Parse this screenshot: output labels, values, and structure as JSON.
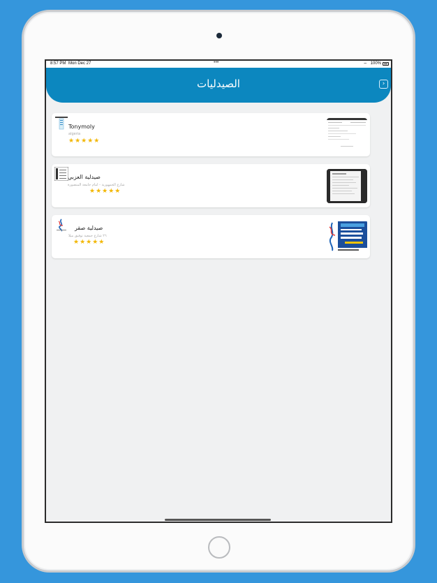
{
  "status_bar": {
    "time": "8:57 PM",
    "date": "Mon Dec 27",
    "dots": "•••",
    "wifi_symbol": "⌔",
    "battery": "100%"
  },
  "header": {
    "title": "الصيدليات",
    "back_symbol": "›"
  },
  "pharmacies": [
    {
      "name": "Tonymoly",
      "address": "algeria",
      "stars": "★★★★★",
      "rating": 5
    },
    {
      "name": "صيدلية العزبي",
      "address": "شارع الجمهورية - امام جامعة المنصورة",
      "stars": "★★★★★",
      "rating": 5
    },
    {
      "name": "صيدلية صقر",
      "address": "٢٦ شارع جمعية توفيق ميلا",
      "stars": "★★★★★",
      "rating": 5
    }
  ],
  "colors": {
    "background": "#3596dc",
    "header": "#0c87bf",
    "star": "#f2b705"
  }
}
